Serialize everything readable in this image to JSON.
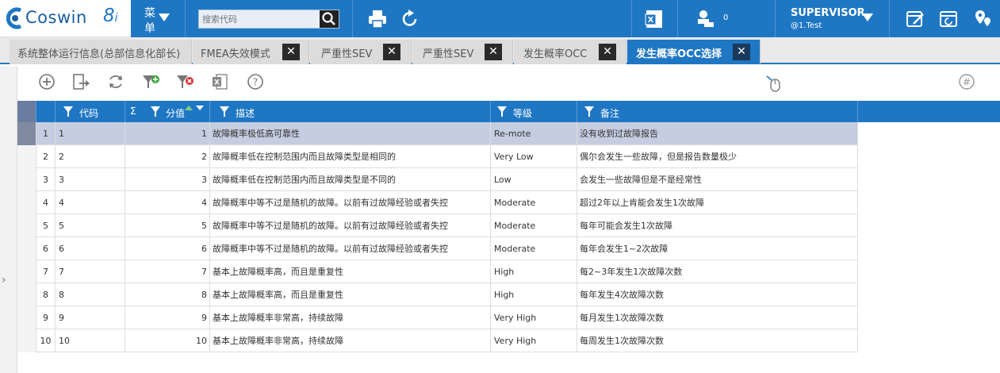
{
  "app": {
    "logo_text": "Coswin",
    "logo_version": "8",
    "logo_version_suffix": "i",
    "menu_line1": "菜",
    "menu_line2": "单",
    "search_placeholder": "搜索代码",
    "notification_count": "0",
    "user_name": "SUPERVISOR",
    "user_sub": "@1.Test",
    "colors": {
      "primary": "#1f77c4",
      "selected_row": "#c5cde0",
      "tab_bg": "#dcdcdc"
    }
  },
  "topbar_icons": [
    "print-icon",
    "refresh-icon",
    "excel-icon",
    "stamp-user-icon",
    "notes-icon",
    "window-refresh-icon",
    "map-pin-icon"
  ],
  "tabs": [
    {
      "label": "系统整体运行信息(总部信息化部长)",
      "closable": false,
      "active": false
    },
    {
      "label": "FMEA失效模式",
      "closable": true,
      "active": false
    },
    {
      "label": "严重性SEV",
      "closable": true,
      "active": false
    },
    {
      "label": "严重性SEV",
      "closable": true,
      "active": false
    },
    {
      "label": "发生概率OCC",
      "closable": true,
      "active": false
    },
    {
      "label": "发生概率OCC选择",
      "closable": true,
      "active": true
    }
  ],
  "close_glyph": "✕",
  "toolbar_icons": [
    "add-icon",
    "export-icon",
    "refresh-icon",
    "add-filter-icon",
    "remove-filter-icon",
    "excel-icon",
    "help-icon",
    "mouse-icon",
    "hash-icon"
  ],
  "grid": {
    "columns": [
      {
        "key": "code",
        "label": "代码"
      },
      {
        "key": "score",
        "label": "分值"
      },
      {
        "key": "desc",
        "label": "描述"
      },
      {
        "key": "level",
        "label": "等级"
      },
      {
        "key": "note",
        "label": "备注"
      }
    ],
    "sum_glyph": "Σ",
    "rows": [
      {
        "idx": "1",
        "code": "1",
        "score": "1",
        "desc": "故障概率极低高可靠性",
        "level": "Re-mote",
        "note": "没有收到过故障报告",
        "selected": true
      },
      {
        "idx": "2",
        "code": "2",
        "score": "2",
        "desc": "故障概率低在控制范围内而且故障类型是相同的",
        "level": "Very Low",
        "note": "偶尔会发生一些故障，但是报告数量极少"
      },
      {
        "idx": "3",
        "code": "3",
        "score": "3",
        "desc": "故障概率低在控制范围内而且故障类型是不同的",
        "level": "Low",
        "note": "会发生一些故障但是不是经常性"
      },
      {
        "idx": "4",
        "code": "4",
        "score": "4",
        "desc": "故障概率中等不过是随机的故障。以前有过故障经验或者失控",
        "level": "Moderate",
        "note": "超过2年以上肯能会发生1次故障"
      },
      {
        "idx": "5",
        "code": "5",
        "score": "5",
        "desc": "故障概率中等不过是随机的故障。以前有过故障经验或者失控",
        "level": "Moderate",
        "note": "每年可能会发生1次故障"
      },
      {
        "idx": "6",
        "code": "6",
        "score": "6",
        "desc": "故障概率中等不过是随机的故障。以前有过故障经验或者失控",
        "level": "Moderate",
        "note": "每年会发生1~2次故障"
      },
      {
        "idx": "7",
        "code": "7",
        "score": "7",
        "desc": "基本上故障概率高，而且是重复性",
        "level": "High",
        "note": "每2~3年发生1次故障次数"
      },
      {
        "idx": "8",
        "code": "8",
        "score": "8",
        "desc": "基本上故障概率高，而且是重复性",
        "level": "High",
        "note": "每年发生4次故障次数"
      },
      {
        "idx": "9",
        "code": "9",
        "score": "9",
        "desc": "基本上故障概率非常高，持续故障",
        "level": "Very High",
        "note": "每月发生1次故障次数"
      },
      {
        "idx": "10",
        "code": "10",
        "score": "10",
        "desc": "基本上故障概率非常高，持续故障",
        "level": "Very High",
        "note": "每周发生1次故障次数"
      }
    ]
  }
}
